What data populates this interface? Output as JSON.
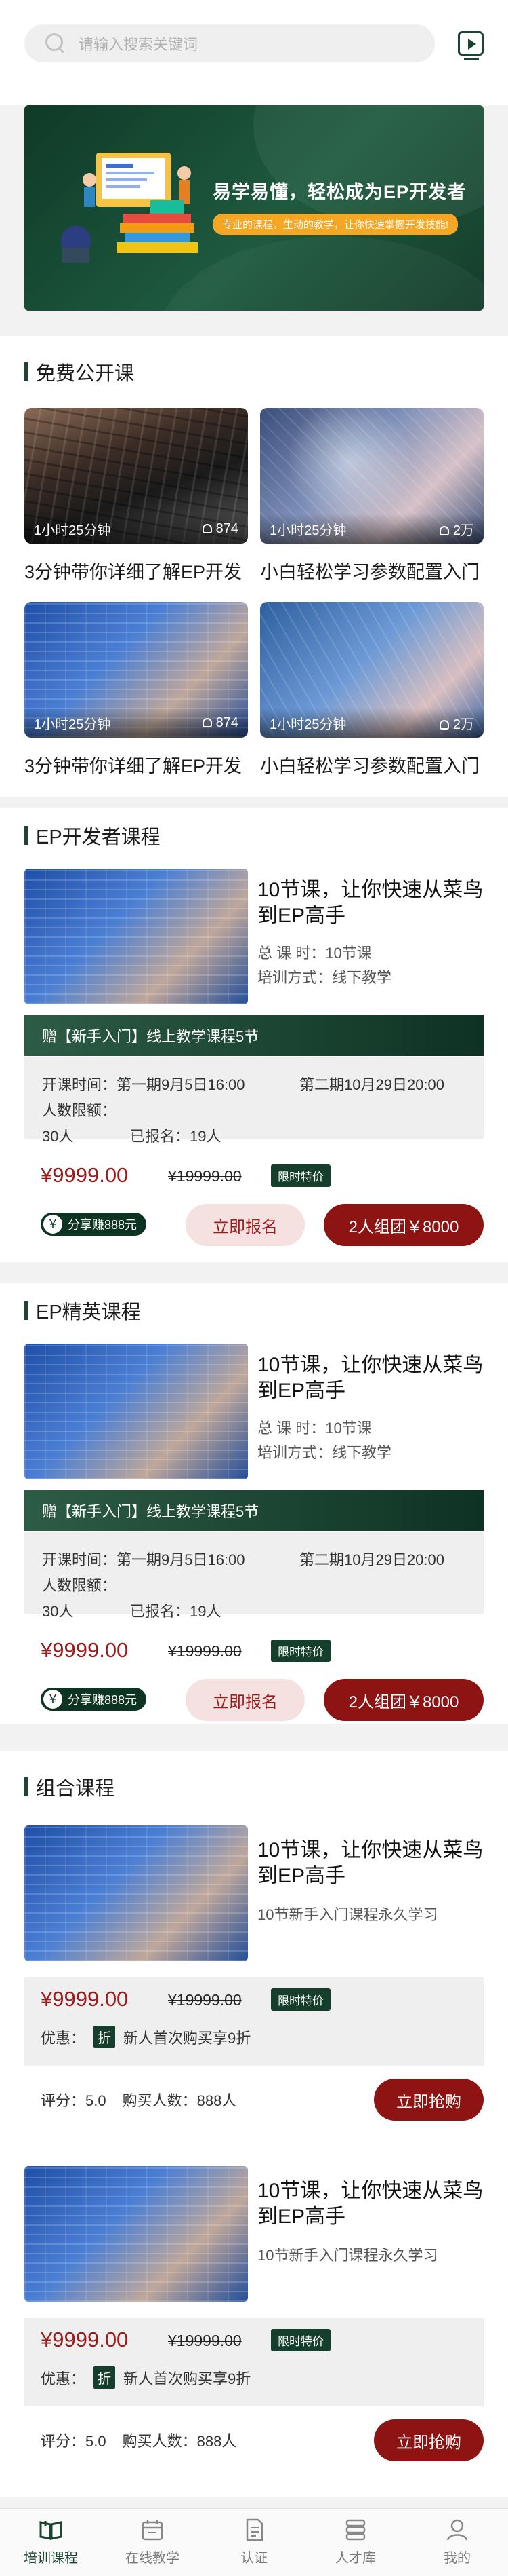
{
  "search": {
    "placeholder": "请输入搜索关键词"
  },
  "banner": {
    "title": "易学易懂，轻松成为EP开发者",
    "subtitle": "专业的课程，生动的教学，让你快速掌握开发技能!"
  },
  "free_section": {
    "title": "免费公开课",
    "cards": [
      {
        "duration": "1小时25分钟",
        "count": "874",
        "title": "3分钟带你详细了解EP开发"
      },
      {
        "duration": "1小时25分钟",
        "count": "2万",
        "title": "小白轻松学习参数配置入门"
      },
      {
        "duration": "1小时25分钟",
        "count": "874",
        "title": "3分钟带你详细了解EP开发"
      },
      {
        "duration": "1小时25分钟",
        "count": "2万",
        "title": "小白轻松学习参数配置入门"
      }
    ]
  },
  "dev_section": {
    "title": "EP开发者课程",
    "course": {
      "title": "10节课，让你快速从菜鸟到EP高手",
      "lessons": "总 课 时：10节课",
      "mode": "培训方式：线下教学",
      "gift": "赠【新手入门】线上教学课程5节",
      "session1": "开课时间：第一期9月5日16:00",
      "session2": "第二期10月29日20:00",
      "limit": "人数限额：30人",
      "enrolled": "已报名：19人",
      "price": "¥9999.00",
      "old_price": "¥19999.00",
      "badge": "限时特价",
      "share_icon": "¥",
      "share": "分享赚888元",
      "enroll_btn": "立即报名",
      "group_btn": "2人组团￥8000"
    }
  },
  "elite_section": {
    "title": "EP精英课程",
    "course": {
      "title": "10节课，让你快速从菜鸟到EP高手",
      "lessons": "总 课 时：10节课",
      "mode": "培训方式：线下教学",
      "gift": "赠【新手入门】线上教学课程5节",
      "session1": "开课时间：第一期9月5日16:00",
      "session2": "第二期10月29日20:00",
      "limit": "人数限额：30人",
      "enrolled": "已报名：19人",
      "price": "¥9999.00",
      "old_price": "¥19999.00",
      "badge": "限时特价",
      "share_icon": "¥",
      "share": "分享赚888元",
      "enroll_btn": "立即报名",
      "group_btn": "2人组团￥8000"
    }
  },
  "combo_section": {
    "title": "组合课程",
    "items": [
      {
        "title": "10节课，让你快速从菜鸟到EP高手",
        "sub": "10节新手入门课程永久学习",
        "price": "¥9999.00",
        "old_price": "¥19999.00",
        "badge": "限时特价",
        "discount_label": "优惠：",
        "zhe": "折",
        "discount": "新人首次购买享9折",
        "rating": "评分：5.0",
        "buyers": "购买人数：888人",
        "buy_btn": "立即抢购"
      },
      {
        "title": "10节课，让你快速从菜鸟到EP高手",
        "sub": "10节新手入门课程永久学习",
        "price": "¥9999.00",
        "old_price": "¥19999.00",
        "badge": "限时特价",
        "discount_label": "优惠：",
        "zhe": "折",
        "discount": "新人首次购买享9折",
        "rating": "评分：5.0",
        "buyers": "购买人数：888人",
        "buy_btn": "立即抢购"
      }
    ]
  },
  "tabbar": [
    {
      "label": "培训课程",
      "icon": "book-icon",
      "active": true
    },
    {
      "label": "在线教学",
      "icon": "calendar-icon",
      "active": false
    },
    {
      "label": "认证",
      "icon": "document-icon",
      "active": false
    },
    {
      "label": "人才库",
      "icon": "database-icon",
      "active": false
    },
    {
      "label": "我的",
      "icon": "user-icon",
      "active": false
    }
  ],
  "colors": {
    "brand_green": "#1d4632",
    "accent_red": "#9a1d1d",
    "button_red": "#8e1313"
  }
}
